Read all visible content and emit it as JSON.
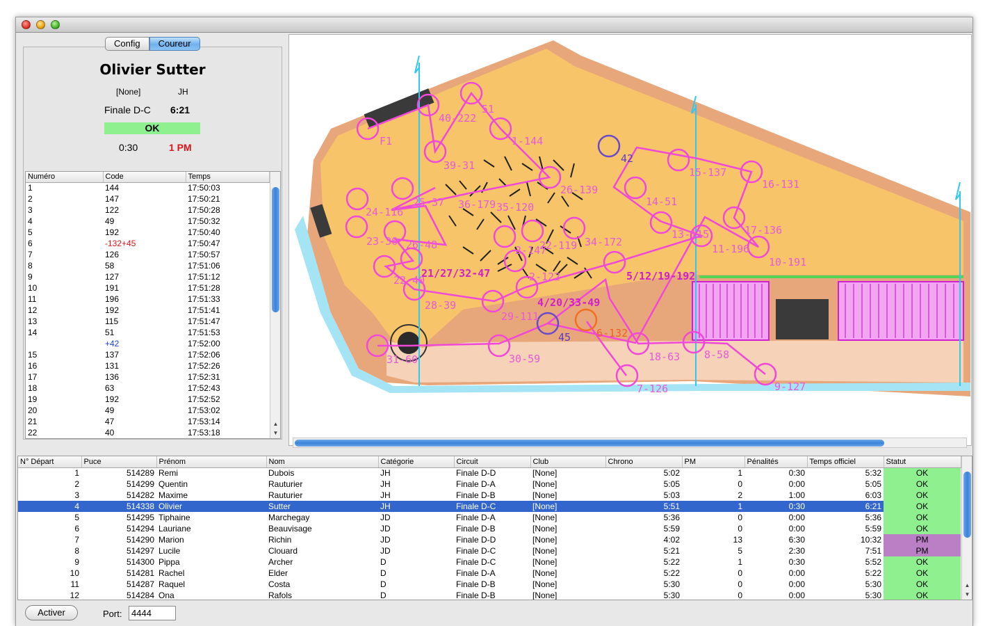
{
  "tabs": {
    "config": "Config",
    "coureur": "Coureur"
  },
  "runner": {
    "name": "Olivier Sutter",
    "club": "[None]",
    "category": "JH",
    "circuit": "Finale D-C",
    "time": "6:21",
    "status": "OK",
    "penalty": "0:30",
    "pm": "1 PM"
  },
  "splits": {
    "headers": [
      "Numéro",
      "Code",
      "Temps"
    ],
    "rows": [
      [
        "1",
        "144",
        "17:50:03",
        ""
      ],
      [
        "2",
        "147",
        "17:50:21",
        ""
      ],
      [
        "3",
        "122",
        "17:50:28",
        ""
      ],
      [
        "4",
        "49",
        "17:50:32",
        ""
      ],
      [
        "5",
        "192",
        "17:50:40",
        ""
      ],
      [
        "6",
        "-132+45",
        "17:50:47",
        "red"
      ],
      [
        "7",
        "126",
        "17:50:57",
        ""
      ],
      [
        "8",
        "58",
        "17:51:06",
        ""
      ],
      [
        "9",
        "127",
        "17:51:12",
        ""
      ],
      [
        "10",
        "191",
        "17:51:28",
        ""
      ],
      [
        "11",
        "196",
        "17:51:33",
        ""
      ],
      [
        "12",
        "192",
        "17:51:41",
        ""
      ],
      [
        "13",
        "115",
        "17:51:47",
        ""
      ],
      [
        "14",
        "51",
        "17:51:53",
        ""
      ],
      [
        "",
        "+42",
        "17:52:00",
        "blue"
      ],
      [
        "15",
        "137",
        "17:52:06",
        ""
      ],
      [
        "16",
        "131",
        "17:52:26",
        ""
      ],
      [
        "17",
        "136",
        "17:52:31",
        ""
      ],
      [
        "18",
        "63",
        "17:52:43",
        ""
      ],
      [
        "19",
        "192",
        "17:52:52",
        ""
      ],
      [
        "20",
        "49",
        "17:53:02",
        ""
      ],
      [
        "21",
        "47",
        "17:53:14",
        ""
      ],
      [
        "22",
        "40",
        "17:53:18",
        ""
      ]
    ]
  },
  "map_labels": [
    "40-222",
    "51",
    "1-144",
    "F1",
    "39-31",
    "42",
    "15-137",
    "16-131",
    "24-116",
    "25-37",
    "36-179",
    "35-120",
    "26-139",
    "14-51",
    "17-136",
    "23-36",
    "26-48",
    "13-115",
    "11-196",
    "2-147",
    "22-119",
    "34-172",
    "10-191",
    "21/27/32-47",
    "5/12/19-192",
    "22-40",
    "2-122",
    "28-39",
    "4/20/33-49",
    "29-111",
    "6-132",
    "45",
    "31-60",
    "30-59",
    "18-63",
    "8-58",
    "7-126",
    "9-127"
  ],
  "results": {
    "headers": [
      "N° Départ",
      "Puce",
      "Prénom",
      "Nom",
      "Catégorie",
      "Circuit",
      "Club",
      "Chrono",
      "PM",
      "Pénalités",
      "Temps officiel",
      "Statut"
    ],
    "rows": [
      [
        "1",
        "514289",
        "Remi",
        "Dubois",
        "JH",
        "Finale D-D",
        "[None]",
        "5:02",
        "1",
        "0:30",
        "5:32",
        "OK"
      ],
      [
        "2",
        "514299",
        "Quentin",
        "Rauturier",
        "JH",
        "Finale D-A",
        "[None]",
        "5:05",
        "0",
        "0:00",
        "5:05",
        "OK"
      ],
      [
        "3",
        "514282",
        "Maxime",
        "Rauturier",
        "JH",
        "Finale D-B",
        "[None]",
        "5:03",
        "2",
        "1:00",
        "6:03",
        "OK"
      ],
      [
        "4",
        "514338",
        "Olivier",
        "Sutter",
        "JH",
        "Finale D-C",
        "[None]",
        "5:51",
        "1",
        "0:30",
        "6:21",
        "OK"
      ],
      [
        "5",
        "514295",
        "Tiphaine",
        "Marchegay",
        "JD",
        "Finale D-A",
        "[None]",
        "5:36",
        "0",
        "0:00",
        "5:36",
        "OK"
      ],
      [
        "6",
        "514294",
        "Lauriane",
        "Beauvisage",
        "JD",
        "Finale D-B",
        "[None]",
        "5:59",
        "0",
        "0:00",
        "5:59",
        "OK"
      ],
      [
        "7",
        "514290",
        "Marion",
        "Richin",
        "JD",
        "Finale D-D",
        "[None]",
        "4:02",
        "13",
        "6:30",
        "10:32",
        "PM"
      ],
      [
        "8",
        "514297",
        "Lucile",
        "Clouard",
        "JD",
        "Finale D-C",
        "[None]",
        "5:21",
        "5",
        "2:30",
        "7:51",
        "PM"
      ],
      [
        "9",
        "514300",
        "Pippa",
        "Archer",
        "D",
        "Finale D-C",
        "[None]",
        "5:22",
        "1",
        "0:30",
        "5:52",
        "OK"
      ],
      [
        "10",
        "514281",
        "Rachel",
        "Elder",
        "D",
        "Finale D-A",
        "[None]",
        "5:22",
        "0",
        "0:00",
        "5:22",
        "OK"
      ],
      [
        "11",
        "514287",
        "Raquel",
        "Costa",
        "D",
        "Finale D-B",
        "[None]",
        "5:30",
        "0",
        "0:00",
        "5:30",
        "OK"
      ],
      [
        "12",
        "514284",
        "Ona",
        "Rafols",
        "D",
        "Finale D-B",
        "[None]",
        "5:30",
        "0",
        "0:00",
        "5:30",
        "OK"
      ]
    ],
    "selected_index": 3
  },
  "footer": {
    "activate_label": "Activer",
    "port_label": "Port:",
    "port_value": "4444"
  },
  "colors": {
    "map_orange": "#f8c46a",
    "course_magenta": "#e040e0",
    "status_ok": "#8ef08e",
    "status_pm": "#bb7fc5",
    "selection": "#3366cc"
  }
}
